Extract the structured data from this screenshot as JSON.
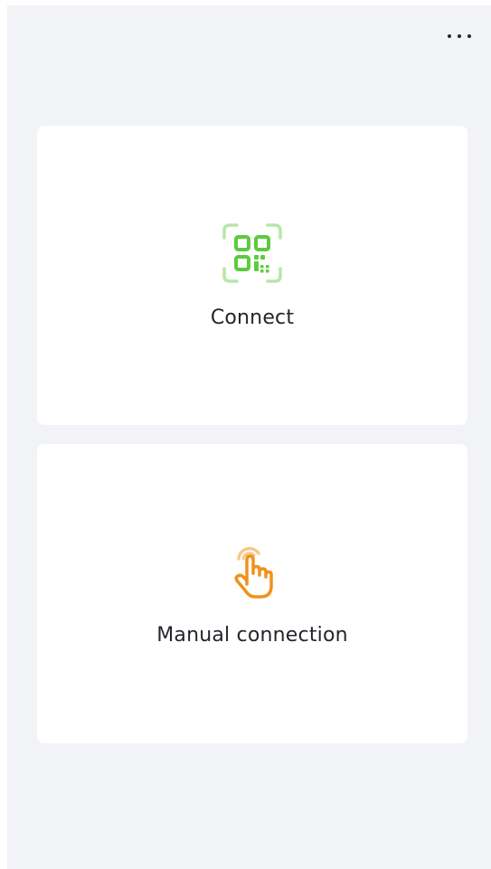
{
  "header": {
    "more_menu_icon": "more-horizontal-icon"
  },
  "options": [
    {
      "label": "Connect",
      "icon": "qr-code-scan-icon",
      "icon_color": "#5ccb3e",
      "icon_accent": "#b6e8a6"
    },
    {
      "label": "Manual connection",
      "icon": "tap-hand-icon",
      "icon_color": "#f0921e",
      "icon_accent": "#f9c88c"
    }
  ],
  "colors": {
    "background": "#f1f3f7",
    "card": "#ffffff",
    "text": "#22262c"
  }
}
